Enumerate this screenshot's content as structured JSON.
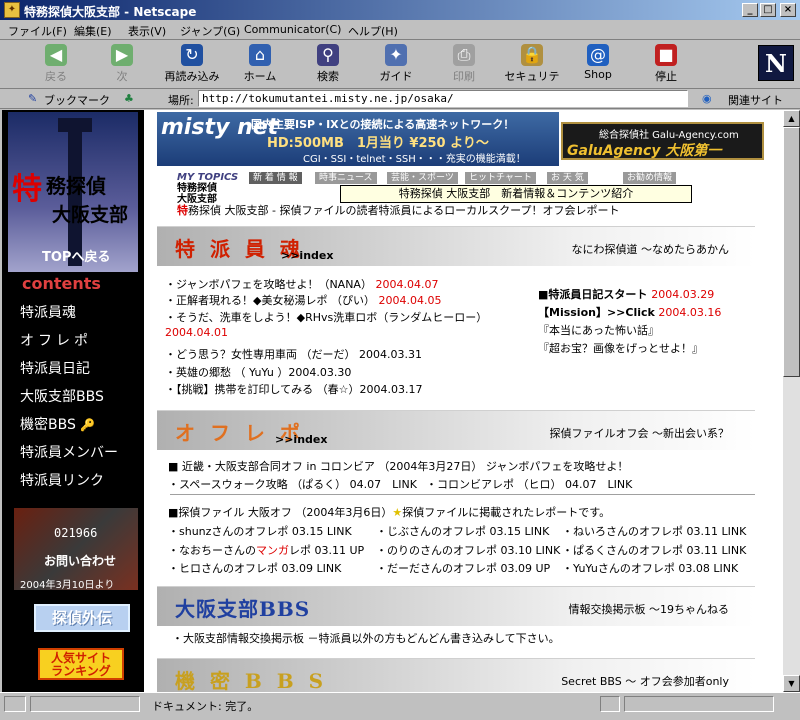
{
  "window": {
    "title": "特務探偵大阪支部 - Netscape",
    "minimize": "_",
    "maximize": "□",
    "close": "×"
  },
  "menu": [
    "ファイル(F)",
    "編集(E)",
    "表示(V)",
    "ジャンプ(G)",
    "Communicator(C)",
    "ヘルプ(H)"
  ],
  "toolbar": [
    {
      "label": "戻る",
      "icon": "◀",
      "enabled": false
    },
    {
      "label": "次",
      "icon": "▶",
      "enabled": false
    },
    {
      "label": "再読み込み",
      "icon": "↻",
      "enabled": true
    },
    {
      "label": "ホーム",
      "icon": "⌂",
      "enabled": true
    },
    {
      "label": "検索",
      "icon": "⚲",
      "enabled": true
    },
    {
      "label": "ガイド",
      "icon": "✦",
      "enabled": true
    },
    {
      "label": "印刷",
      "icon": "⎙",
      "enabled": false
    },
    {
      "label": "セキュリティ",
      "icon": "🔒",
      "enabled": true
    },
    {
      "label": "Shop",
      "icon": "@",
      "enabled": true
    },
    {
      "label": "停止",
      "icon": "■",
      "enabled": true
    }
  ],
  "netscape_logo": "N",
  "location": {
    "bookmarks_label": "ブックマーク",
    "location_label": "場所:",
    "url": "http://tokumutantei.misty.ne.jp/osaka/",
    "related_label": "関連サイト"
  },
  "sidebar": {
    "logo_toku": "特",
    "logo_line1": "務探偵",
    "logo_line2": "大阪支部",
    "logo_back": "TOPへ戻る",
    "contents_heading": "contents",
    "items": [
      "特派員魂",
      "オフレポ",
      "特派員日記",
      "大阪支部BBS",
      "機密BBS",
      "特派員メンバー",
      "特派員リンク"
    ],
    "counter": "021966",
    "inquiry": "お問い合わせ",
    "counter_date": "2004年3月10日より",
    "tantei_btn": "探偵外伝",
    "ranking_btn_l1": "人気サイト",
    "ranking_btn_l2": "ランキング"
  },
  "banners": {
    "misty_logo": "misty net",
    "misty_line1": "国内主要ISP・IXとの接続による高速ネットワーク！",
    "misty_line2": "HD:500MB　1月当り ¥250 より～",
    "misty_line3": "CGI・SSI・telnet・SSH・・・充実の機能満載！",
    "galu_line1": "総合探偵社 Galu-Agency.com",
    "galu_line2": "GaluAgency 大阪第一"
  },
  "topics": {
    "logo_l1": "MY TOPICS",
    "logo_l2": "特務探偵",
    "logo_l3": "大阪支部",
    "tabs": [
      "新 着 情 報",
      "時事ニュース",
      "芸能・スポーツ",
      "ヒットチャート",
      "お 天 気",
      "お勧め情報"
    ],
    "tooltip": "特務探偵 大阪支部　新着情報＆コンテンツ紹介",
    "ticker_red": "特",
    "ticker_text": "務探偵 大阪支部 - 探偵ファイルの読者特派員によるローカルスクープ！オフ会レポート"
  },
  "sections": {
    "tokuhain": {
      "title": "特 派 員 魂",
      "index": ">>index",
      "subtitle": "なにわ探偵道 ～なめたらあかん",
      "items": [
        {
          "text": "・ジャンボパフェを攻略せよ！（NANA）",
          "date": "2004.04.07"
        },
        {
          "text": "・正解者現れる！◆美女秘湯レポ （ぴい）",
          "date": "2004.04.05"
        },
        {
          "text": "・そうだ、洗車をしよう！◆RHvs洗車ロボ（ランダムヒーロー）",
          "date": ""
        },
        {
          "text": "",
          "date": "2004.04.01"
        },
        {
          "text": "・どう思う？女性専用車両 （だーだ） 2004.03.31",
          "date": ""
        },
        {
          "text": "・英雄の郷愁 （ YuYu ）2004.03.30",
          "date": ""
        },
        {
          "text": "・【挑戦】携帯を訂印してみる （春☆）2004.03.17",
          "date": ""
        }
      ],
      "diary": [
        {
          "text": "■特派員日記スタート",
          "date": "2004.03.29"
        },
        {
          "text": "【Mission】>>Click",
          "date": "2004.03.16"
        },
        {
          "text": "『本当にあった怖い話』",
          "date": ""
        },
        {
          "text": "『超お宝？画像をげっとせよ！』",
          "date": ""
        }
      ]
    },
    "offrepo": {
      "title": "オ フ レ ポ",
      "index": ">>index",
      "subtitle": "探偵ファイルオフ会 ～新出会い系？",
      "line1": "■ 近畿・大阪支部合同オフ in コロンビア （2004年3月27日） ジャンボパフェを攻略せよ！",
      "line2a": "・スペースウォーク攻略 （ぱるく） 04.07　LINK",
      "line2b": "・コロンビアレポ （ヒロ） 04.07　LINK",
      "line3a": "■探偵ファイル 大阪オフ （2004年3月6日）",
      "line3star": "★",
      "line3b": "探偵ファイルに掲載されたレポートです。",
      "reports": [
        "・shunzさんのオフレポ 03.15 LINK",
        "・じぶさんのオフレポ 03.15 LINK",
        "・ねいろさんのオフレポ 03.11 LINK",
        "・なおちーさんの|マンガ|レポ 03.11 UP",
        "・のりのさんのオフレポ 03.10 LINK",
        "・ぱるくさんのオフレポ 03.11 LINK",
        "・ヒロさんのオフレポ 03.09 LINK",
        "・だーださんのオフレポ 03.09 UP",
        "・YuYuさんのオフレポ 03.08 LINK"
      ]
    },
    "bbs": {
      "title": "大阪支部BBS",
      "subtitle": "情報交換掲示板 ～19ちゃんねる",
      "line": "・大阪支部情報交換掲示板 －特派員以外の方もどんどん書き込みして下さい。"
    },
    "kimitsu": {
      "title": "機 密 B B S",
      "subtitle": "Secret BBS ～ オフ会参加者only"
    }
  },
  "status": {
    "text": "ドキュメント: 完了。"
  },
  "colors": {
    "accent_red": "#dd0000",
    "titlebar": "#0a246a",
    "chrome": "#c0c0c0"
  }
}
